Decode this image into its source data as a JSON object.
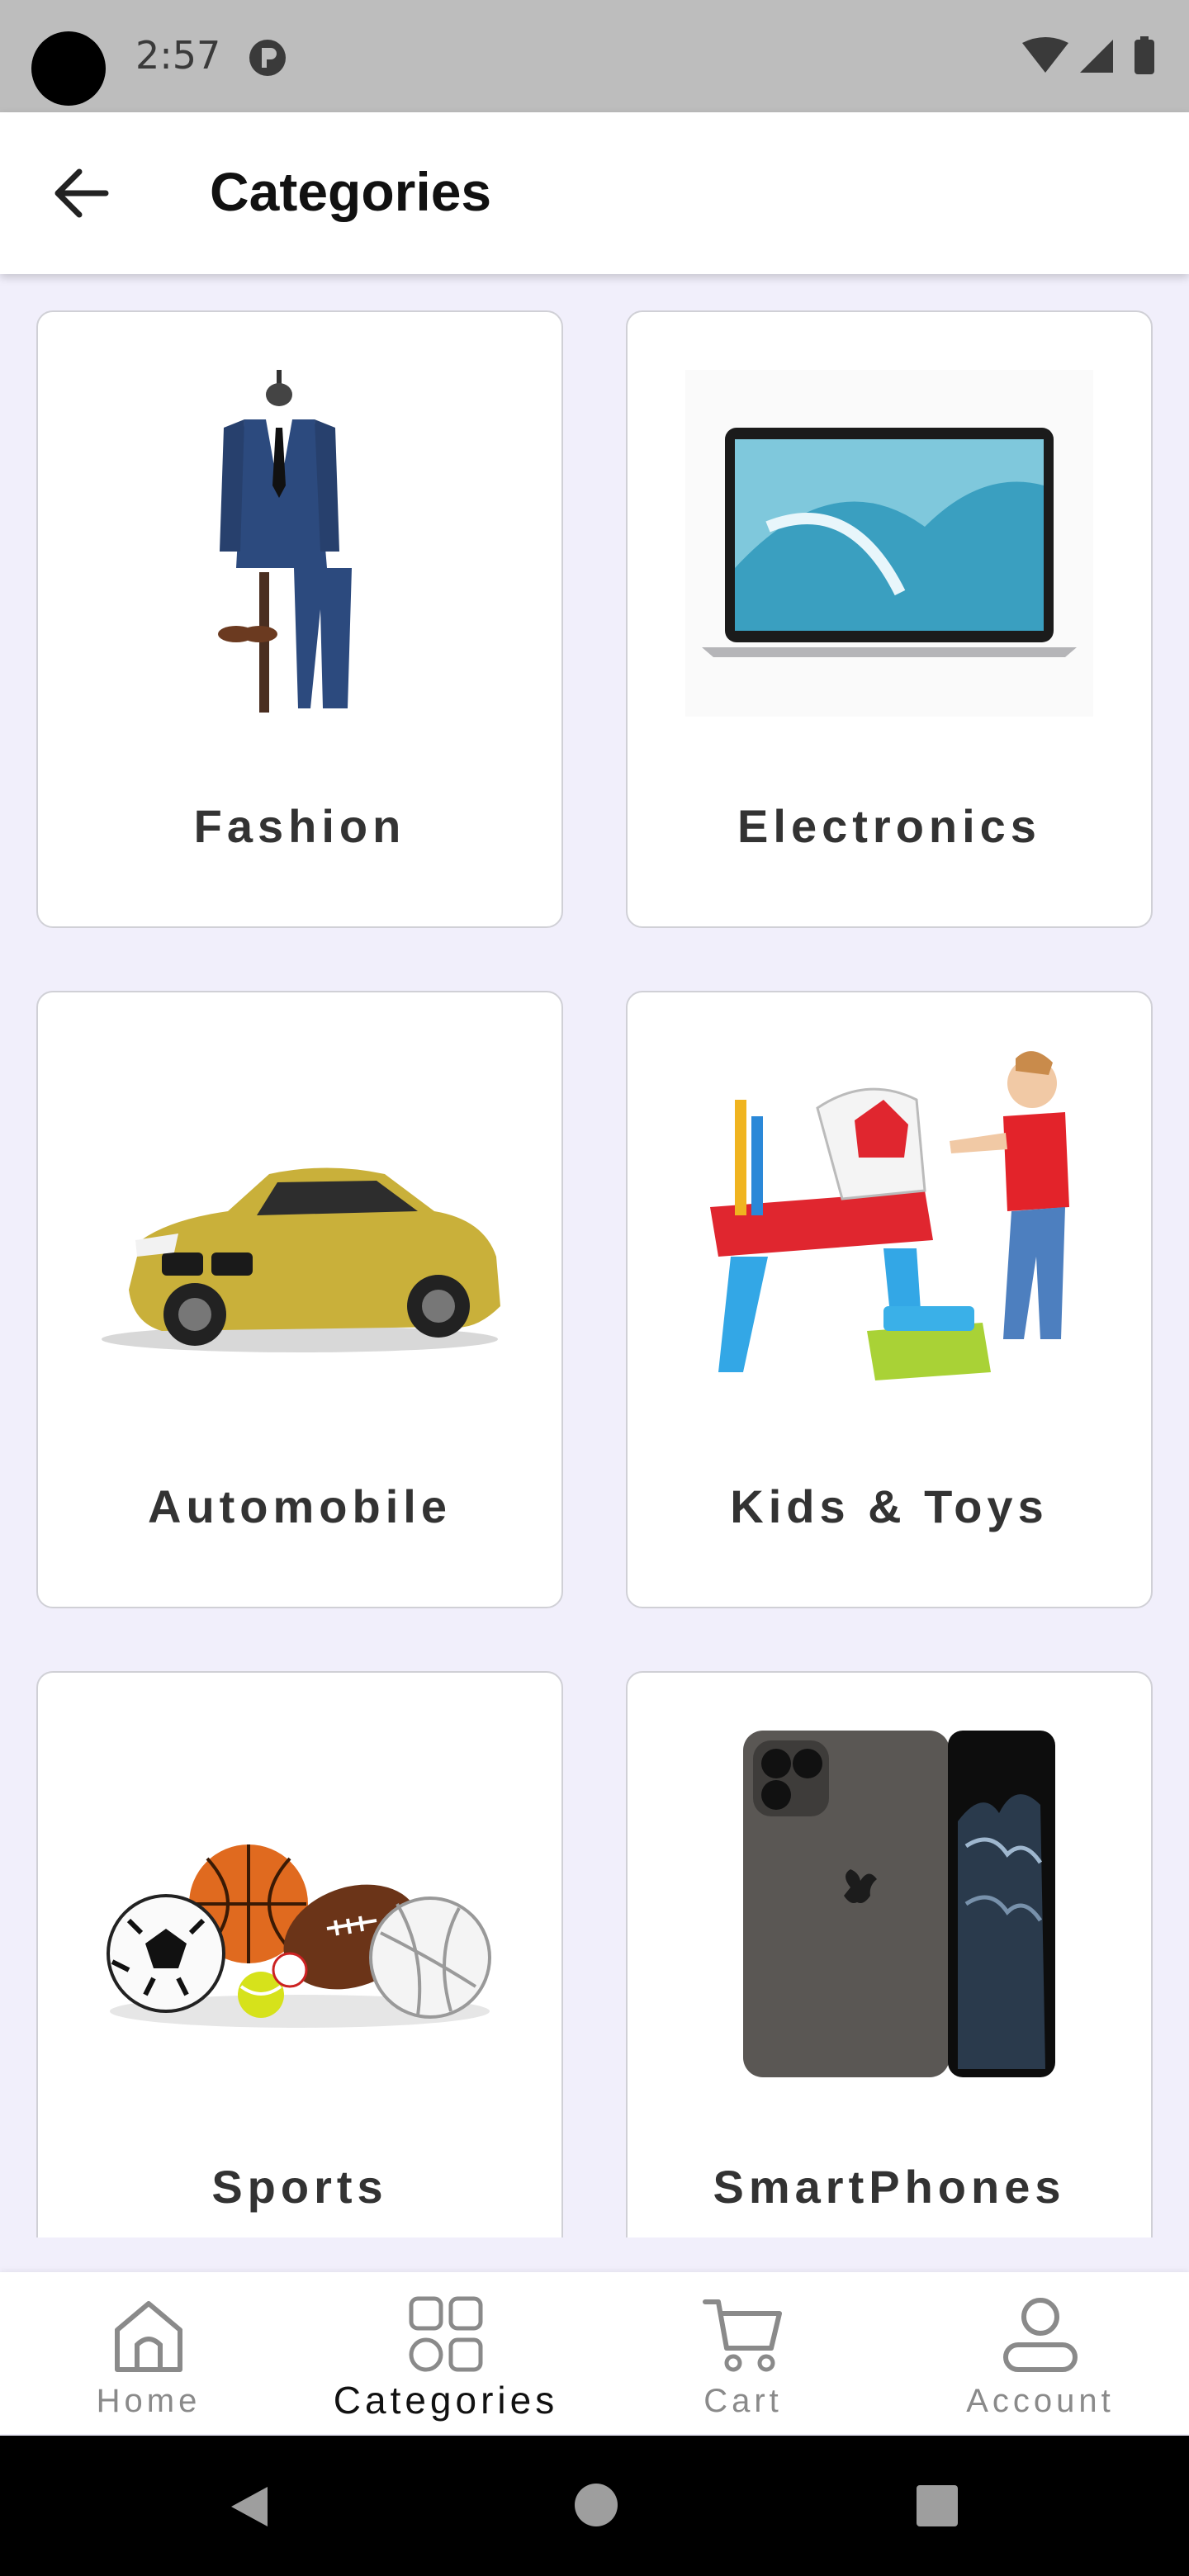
{
  "status_bar": {
    "time": "2:57"
  },
  "app_bar": {
    "title": "Categories"
  },
  "categories": [
    {
      "label": "Fashion",
      "image": "suit-icon"
    },
    {
      "label": "Electronics",
      "image": "laptop-icon"
    },
    {
      "label": "Automobile",
      "image": "car-icon"
    },
    {
      "label": "Kids & Toys",
      "image": "toy-easel-icon"
    },
    {
      "label": "Sports",
      "image": "sports-balls-icon"
    },
    {
      "label": "SmartPhones",
      "image": "smartphone-icon"
    }
  ],
  "bottom_nav": {
    "items": [
      {
        "label": "Home",
        "icon": "home-icon",
        "active": false
      },
      {
        "label": "Categories",
        "icon": "categories-icon",
        "active": true
      },
      {
        "label": "Cart",
        "icon": "cart-icon",
        "active": false
      },
      {
        "label": "Account",
        "icon": "account-icon",
        "active": false
      }
    ]
  },
  "colors": {
    "background": "#f1effb",
    "card": "#ffffff",
    "status_bar": "#bdbdbd",
    "system_nav": "#000000"
  }
}
